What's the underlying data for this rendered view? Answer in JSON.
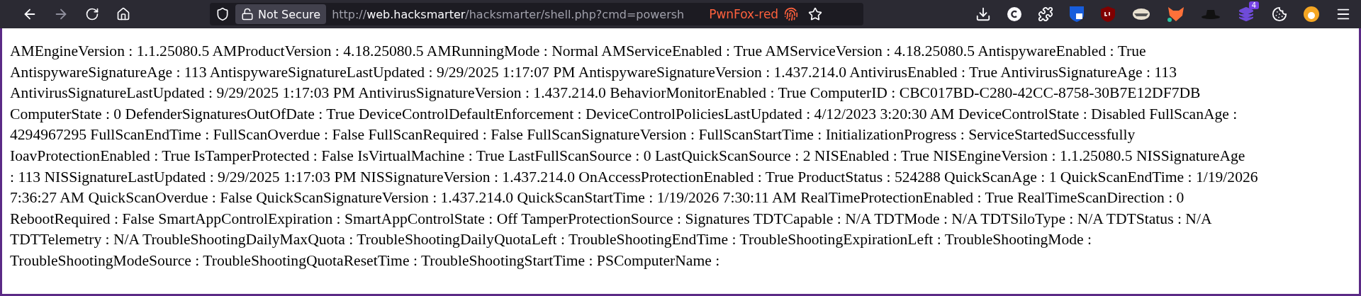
{
  "toolbar": {
    "security_label": "Not Secure",
    "url_host_prefix": "http://",
    "url_host": "web.hacksmarter",
    "url_path": "/hacksmarter/shell.php?cmd=powersh",
    "container_label": "PwnFox-red",
    "extension_badge": "4"
  },
  "page": {
    "lines": [
      "AMEngineVersion : 1.1.25080.5 AMProductVersion : 4.18.25080.5 AMRunningMode : Normal AMServiceEnabled : True AMServiceVersion : 4.18.25080.5 AntispywareEnabled : True",
      "AntispywareSignatureAge : 113 AntispywareSignatureLastUpdated : 9/29/2025 1:17:07 PM AntispywareSignatureVersion : 1.437.214.0 AntivirusEnabled : True AntivirusSignatureAge : 113",
      "AntivirusSignatureLastUpdated : 9/29/2025 1:17:03 PM AntivirusSignatureVersion : 1.437.214.0 BehaviorMonitorEnabled : True ComputerID : CBC017BD-C280-42CC-8758-30B7E12DF7DB",
      "ComputerState : 0 DefenderSignaturesOutOfDate : True DeviceControlDefaultEnforcement : DeviceControlPoliciesLastUpdated : 4/12/2023 3:20:30 AM DeviceControlState : Disabled FullScanAge :",
      "4294967295 FullScanEndTime : FullScanOverdue : False FullScanRequired : False FullScanSignatureVersion : FullScanStartTime : InitializationProgress : ServiceStartedSuccessfully",
      "IoavProtectionEnabled : True IsTamperProtected : False IsVirtualMachine : True LastFullScanSource : 0 LastQuickScanSource : 2 NISEnabled : True NISEngineVersion : 1.1.25080.5 NISSignatureAge",
      ": 113 NISSignatureLastUpdated : 9/29/2025 1:17:03 PM NISSignatureVersion : 1.437.214.0 OnAccessProtectionEnabled : True ProductStatus : 524288 QuickScanAge : 1 QuickScanEndTime : 1/19/2026",
      "7:36:27 AM QuickScanOverdue : False QuickScanSignatureVersion : 1.437.214.0 QuickScanStartTime : 1/19/2026 7:30:11 AM RealTimeProtectionEnabled : True RealTimeScanDirection : 0",
      "RebootRequired : False SmartAppControlExpiration : SmartAppControlState : Off TamperProtectionSource : Signatures TDTCapable : N/A TDTMode : N/A TDTSiloType : N/A TDTStatus : N/A",
      "TDTTelemetry : N/A TroubleShootingDailyMaxQuota : TroubleShootingDailyQuotaLeft : TroubleShootingEndTime : TroubleShootingExpirationLeft : TroubleShootingMode :",
      "TroubleShootingModeSource : TroubleShootingQuotaResetTime : TroubleShootingStartTime : PSComputerName :"
    ]
  }
}
